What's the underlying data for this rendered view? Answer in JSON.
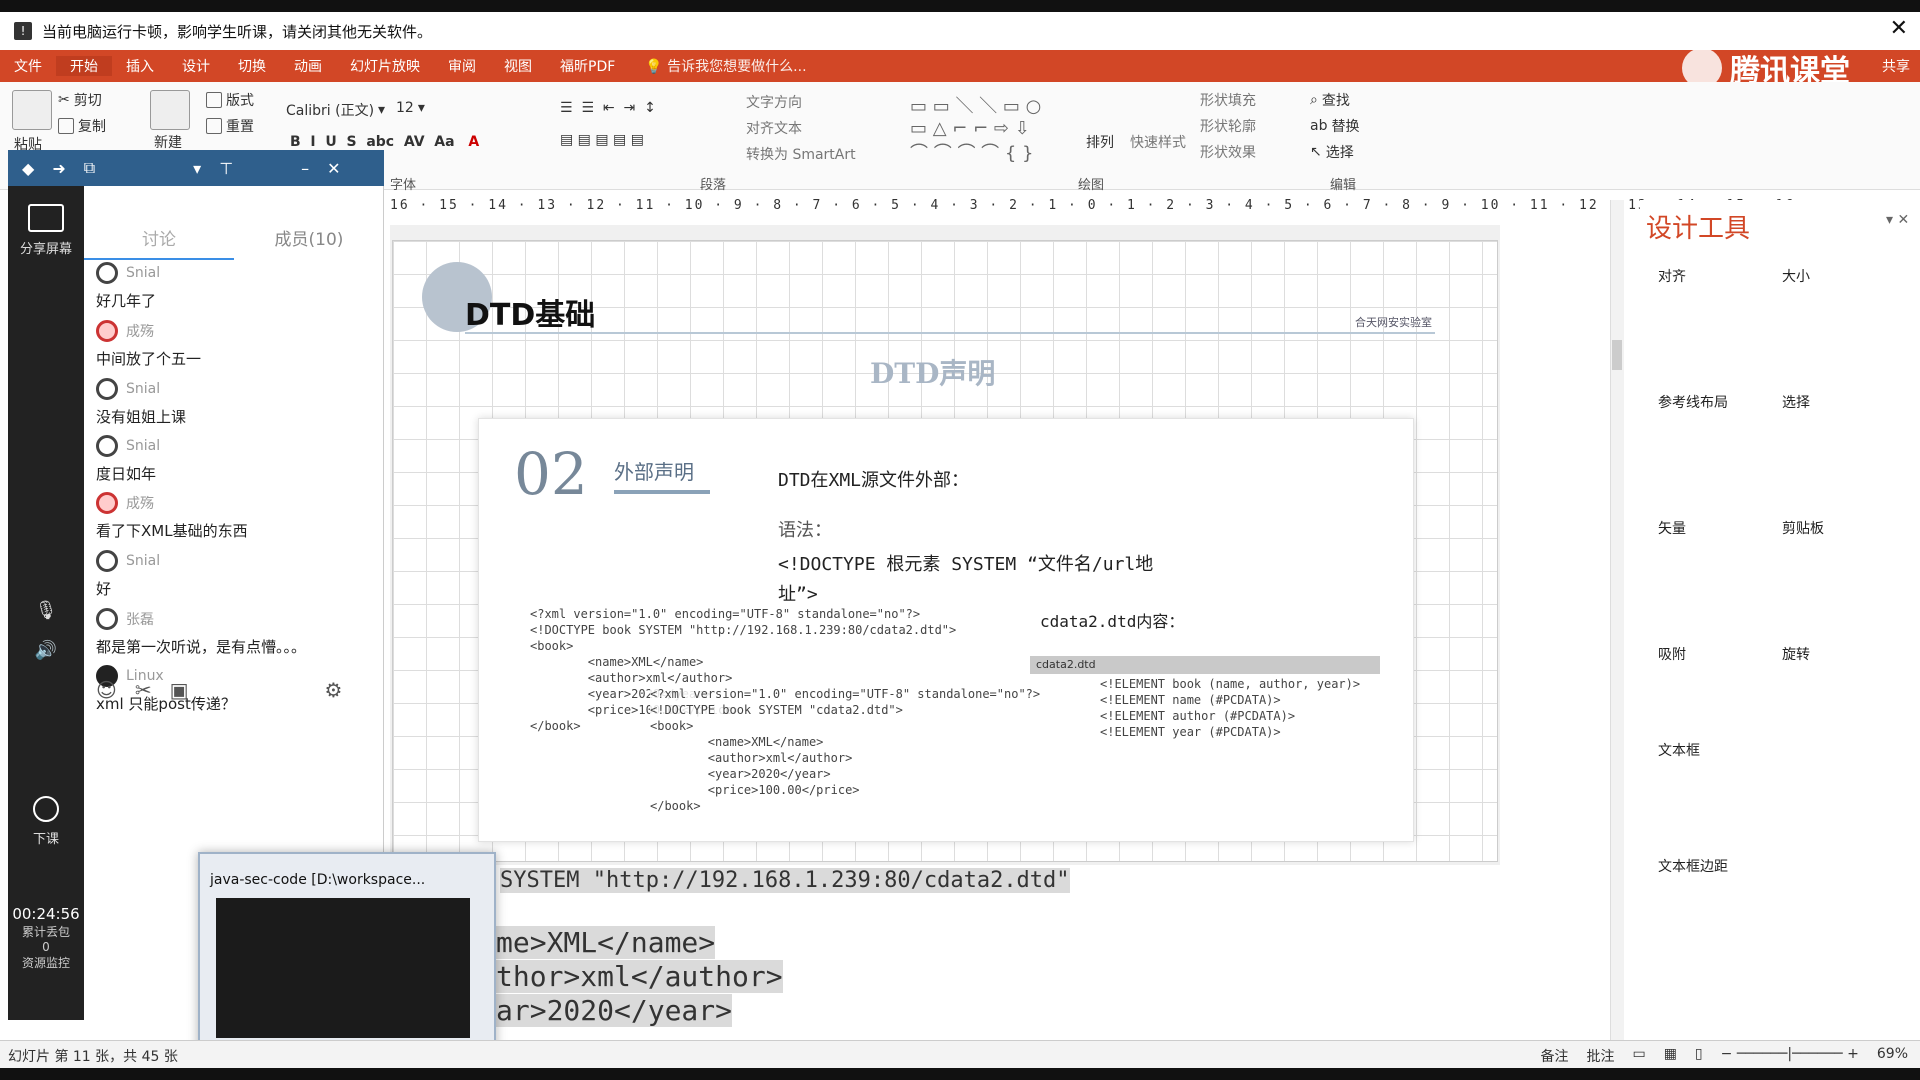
{
  "notice": {
    "text": "当前电脑运行卡顿，影响学生听课，请关闭其他无关软件。",
    "close": "✕"
  },
  "ribbon": {
    "tabs": [
      "文件",
      "开始",
      "插入",
      "设计",
      "切换",
      "动画",
      "幻灯片放映",
      "审阅",
      "视图",
      "福昕PDF"
    ],
    "search": "告诉我您想要做什么...",
    "brand": "腾讯课堂",
    "share": "共享"
  },
  "toolbar": {
    "paste": "粘贴",
    "cut": "剪切",
    "copy": "复制",
    "new_slide": "新建",
    "layout": "版式",
    "reset": "重置",
    "font_name": "Calibri (正文)",
    "font_size": "12",
    "text_direction": "文字方向",
    "align_text": "对齐文本",
    "smartart": "转换为 SmartArt",
    "arrange": "排列",
    "quick_styles": "快速样式",
    "shape_fill": "形状填充",
    "shape_outline": "形状轮廓",
    "shape_effect": "形状效果",
    "find": "查找",
    "replace": "替换",
    "select": "选择",
    "groups": {
      "font": "字体",
      "paragraph": "段落",
      "drawing": "绘图",
      "editing": "编辑"
    }
  },
  "ruler": "16 · 15 · 14 · 13 · 12 · 11 · 10 · 9 · 8 · 7 · 6 · 5 · 4 · 3 · 2 · 1 · 0 · 1 · 2 · 3 · 4 · 5 · 6 · 7 · 8 · 9 · 10 · 11 · 12 · 13 · 14 · 15 · 16",
  "leftbar": {
    "share_screen": "分享屏幕",
    "end_class": "下课",
    "timer": "00:24:56",
    "packet_loss": "累计丢包",
    "packet_loss_value": "0",
    "resource_monitor": "资源监控"
  },
  "chat": {
    "tabs": [
      "讨论",
      "成员(10)"
    ],
    "messages": [
      {
        "user": "Snial",
        "text": "好几年了"
      },
      {
        "user": "成殇",
        "text": "中间放了个五一"
      },
      {
        "user": "Snial",
        "text": "没有姐姐上课"
      },
      {
        "user": "Snial",
        "text": "度日如年"
      },
      {
        "user": "成殇",
        "text": "看了下XML基础的东西"
      },
      {
        "user": "Snial",
        "text": "好"
      },
      {
        "user": "张磊",
        "text": "都是第一次听说，是有点懵。。。"
      },
      {
        "user": "Linux",
        "text": "xml 只能post传递？"
      }
    ]
  },
  "slide": {
    "title": "DTD基础",
    "logo_text": "合天网安实验室",
    "subtitle": "DTD声明",
    "section_num": "02",
    "section_title": "外部声明",
    "line1": "DTD在XML源文件外部：",
    "line2": "语法：",
    "line3": "<!DOCTYPE 根元素 SYSTEM “文件名/url地",
    "line4": "址”>",
    "dtd_label": "cdata2.dtd内容：",
    "code1": "<?xml version=\"1.0\" encoding=\"UTF-8\" standalone=\"no\"?>\n<!DOCTYPE book SYSTEM \"http://192.168.1.239:80/cdata2.dtd\">\n<book>\n        <name>XML</name>\n        <author>xml</author>\n        <year>2020</year>\n        <price>100.00</price>\n</book>",
    "code2": "<?xml version=\"1.0\" encoding=\"UTF-8\" standalone=\"no\"?>\n<!DOCTYPE book SYSTEM \"cdata2.dtd\">\n<book>\n        <name>XML</name>\n        <author>xml</author>\n        <year>2020</year>\n        <price>100.00</price>\n</book>",
    "dtd_tab": "cdata2.dtd",
    "code3": "<!ELEMENT book (name, author, year)>\n<!ELEMENT name (#PCDATA)>\n<!ELEMENT author (#PCDATA)>\n<!ELEMENT year (#PCDATA)>"
  },
  "editor": {
    "lines": [
      "SYSTEM \"http://192.168.1.239:80/cdata2.dtd\"",
      "me>XML</name>",
      "thor>xml</author>",
      "ar>2020</year>"
    ]
  },
  "design": {
    "title": "设计工具",
    "labels": [
      "对齐",
      "大小",
      "参考线布局",
      "选择",
      "矢量",
      "剪贴板",
      "吸附",
      "旋转",
      "文本框",
      "文本框边距"
    ]
  },
  "thumbnail": {
    "title": "java-sec-code [D:\\workspace..."
  },
  "status": {
    "slide_info": "幻灯片 第 11 张，共 45 张",
    "notes": "备注",
    "comments": "批注",
    "zoom": "69%"
  },
  "colors": {
    "accent": "#d24726",
    "sidebar": "#222222",
    "chat_header": "#2f5f8c"
  }
}
